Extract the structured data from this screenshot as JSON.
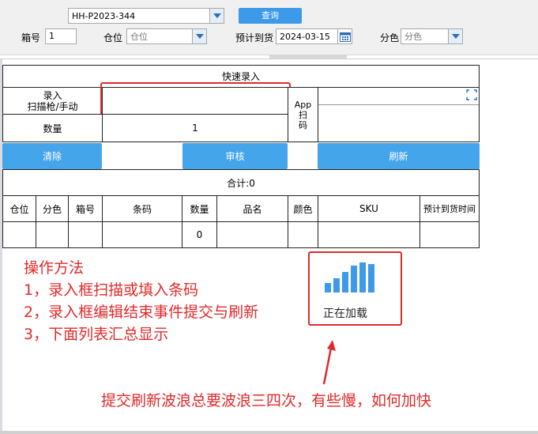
{
  "filters": {
    "order_value": "HH-P2023-344",
    "query_label": "查询",
    "box_label": "箱号",
    "box_value": "1",
    "location_label": "仓位",
    "location_placeholder": "仓位",
    "eta_label": "预计到货",
    "eta_value": "2024-03-15",
    "color_label": "分色",
    "color_placeholder": "分色"
  },
  "quick_entry": {
    "title": "快速录入",
    "input_label_line1": "录入",
    "input_label_line2": "扫描枪/手动",
    "input_value": "",
    "qty_label": "数量",
    "qty_value": "1",
    "app_label_line1": "App",
    "app_label_line2": "扫",
    "app_label_line3": "码"
  },
  "actions": {
    "clear_label": "清除",
    "review_label": "审核",
    "refresh_label": "刷新"
  },
  "summary": {
    "total_label": "合计:0",
    "columns": [
      "仓位",
      "分色",
      "箱号",
      "条码",
      "数量",
      "品名",
      "颜色",
      "SKU",
      "预计到货时间"
    ],
    "row": [
      "",
      "",
      "",
      "",
      "0",
      "",
      "",
      "",
      ""
    ]
  },
  "annotation": {
    "heading": "操作方法",
    "step1": "1，录入框扫描或填入条码",
    "step2": "2，录入框编辑结束事件提交与刷新",
    "step3": "3，下面列表汇总显示",
    "loading_text": "正在加载",
    "question": "提交刷新波浪总要波浪三四次，有些慢，如何加快"
  },
  "colors": {
    "accent_blue": "#45a5ea",
    "annotation_red": "#e02a2a"
  }
}
